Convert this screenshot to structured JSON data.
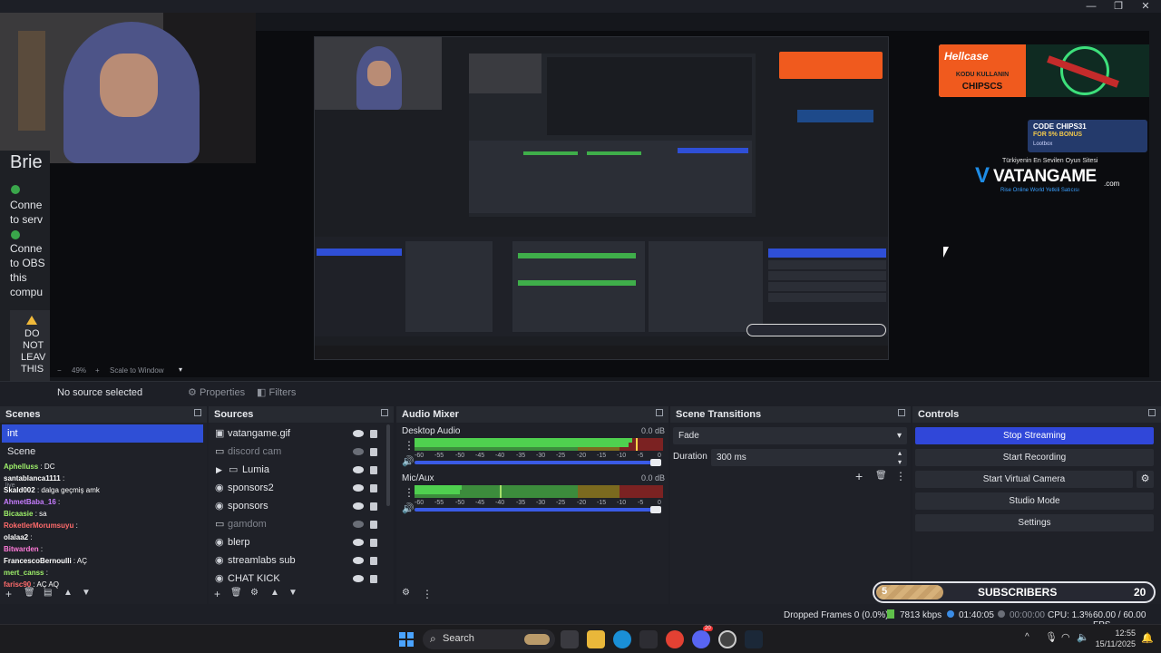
{
  "window": {
    "minimize": "—",
    "maximize": "❐",
    "close": "✕"
  },
  "left_dialog": {
    "title": "Brie",
    "lines": [
      "Conne",
      "to serv",
      "Conne",
      "to OBS",
      "this",
      "compu"
    ],
    "warning": [
      "DO",
      "NOT",
      "LEAV",
      "THIS"
    ]
  },
  "ads": {
    "hellcase_brand": "Hellcase",
    "hellcase_line1": "KODU KULLANIN",
    "hellcase_line2": "CHIPSCS",
    "lootbox_code": "CODE CHIPS31",
    "lootbox_bonus": "FOR 5% BONUS",
    "lootbox_brand": "Lootbox",
    "vatangame_tagline": "Türkiyenin En Sevilen Oyun Sitesi",
    "vatangame_name": "VATANGAME",
    "vatangame_tld": ".com",
    "vatangame_sub": "Rise Online World Yetkili Satıcısı"
  },
  "zoom": {
    "value": "49%",
    "mode": "Scale to Window"
  },
  "source_bar": {
    "status": "No source selected",
    "properties": "Properties",
    "filters": "Filters"
  },
  "scenes": {
    "title": "Scenes",
    "items": [
      "int",
      "Scene"
    ],
    "chat": [
      {
        "user": "Aphelluss",
        "msg": ": DC",
        "color": "#9ef06a"
      },
      {
        "user": "santablanca1111",
        "msg": ":",
        "color": "#ffffff"
      },
      {
        "user": "Skald002",
        "msg": ": dalga geçmiş amk",
        "color": "#ffffff"
      },
      {
        "user": "AhmetBaba_16",
        "msg": ":",
        "color": "#c77dff"
      },
      {
        "user": "Bicaasie",
        "msg": ": sa",
        "color": "#9ef06a"
      },
      {
        "user": "RoketlerMorumsuyu",
        "msg": ":",
        "color": "#ff6b6b"
      },
      {
        "user": "olalaa2",
        "msg": ":",
        "color": "#ffffff"
      },
      {
        "user": "Bitwarden",
        "msg": ":",
        "color": "#ff7ad9"
      },
      {
        "user": "FrancescoBernoulli",
        "msg": ": AÇ",
        "color": "#ffffff"
      },
      {
        "user": "mert_canss",
        "msg": ":",
        "color": "#9ef06a"
      },
      {
        "user": "farisc90",
        "msg": ": AÇ AQ",
        "color": "#ff6b6b"
      }
    ],
    "chat_tag": "live"
  },
  "sources": {
    "title": "Sources",
    "items": [
      {
        "name": "vatangame.gif",
        "icon": "image-icon",
        "visible": true,
        "group": false
      },
      {
        "name": "discord cam",
        "icon": "window-icon",
        "visible": false,
        "group": false
      },
      {
        "name": "Lumia",
        "icon": "folder-icon",
        "visible": true,
        "group": true
      },
      {
        "name": "sponsors2",
        "icon": "browser-icon",
        "visible": true,
        "group": false
      },
      {
        "name": "sponsors",
        "icon": "browser-icon",
        "visible": true,
        "group": false
      },
      {
        "name": "gamdom",
        "icon": "window-icon",
        "visible": false,
        "group": false
      },
      {
        "name": "blerp",
        "icon": "browser-icon",
        "visible": true,
        "group": false
      },
      {
        "name": "streamlabs sub",
        "icon": "browser-icon",
        "visible": true,
        "group": false
      },
      {
        "name": "CHAT KICK",
        "icon": "browser-icon",
        "visible": true,
        "group": false
      }
    ]
  },
  "mixer": {
    "title": "Audio Mixer",
    "channels": [
      {
        "name": "Desktop Audio",
        "db": "0.0 dB"
      },
      {
        "name": "Mic/Aux",
        "db": "0.0 dB"
      }
    ],
    "ticks": [
      "-60",
      "-55",
      "-50",
      "-45",
      "-40",
      "-35",
      "-30",
      "-25",
      "-20",
      "-15",
      "-10",
      "-5",
      "0"
    ]
  },
  "transitions": {
    "title": "Scene Transitions",
    "selected": "Fade",
    "duration_label": "Duration",
    "duration_value": "300 ms"
  },
  "controls": {
    "title": "Controls",
    "buttons": [
      "Stop Streaming",
      "Start Recording",
      "Start Virtual Camera",
      "Studio Mode",
      "Settings"
    ]
  },
  "subs_widget": {
    "current": "5",
    "label": "SUBSCRIBERS",
    "goal": "20"
  },
  "status": {
    "dropped": "Dropped Frames 0 (0.0%)",
    "kbps": "7813 kbps",
    "stream_time": "01:40:05",
    "rec_time": "00:00:00",
    "cpu": "CPU: 1.3%",
    "fps": "60.00 / 60.00 FPS"
  },
  "taskbar": {
    "search": "Search",
    "time": "12:55",
    "date": "15/11/2025",
    "badge": "20"
  }
}
